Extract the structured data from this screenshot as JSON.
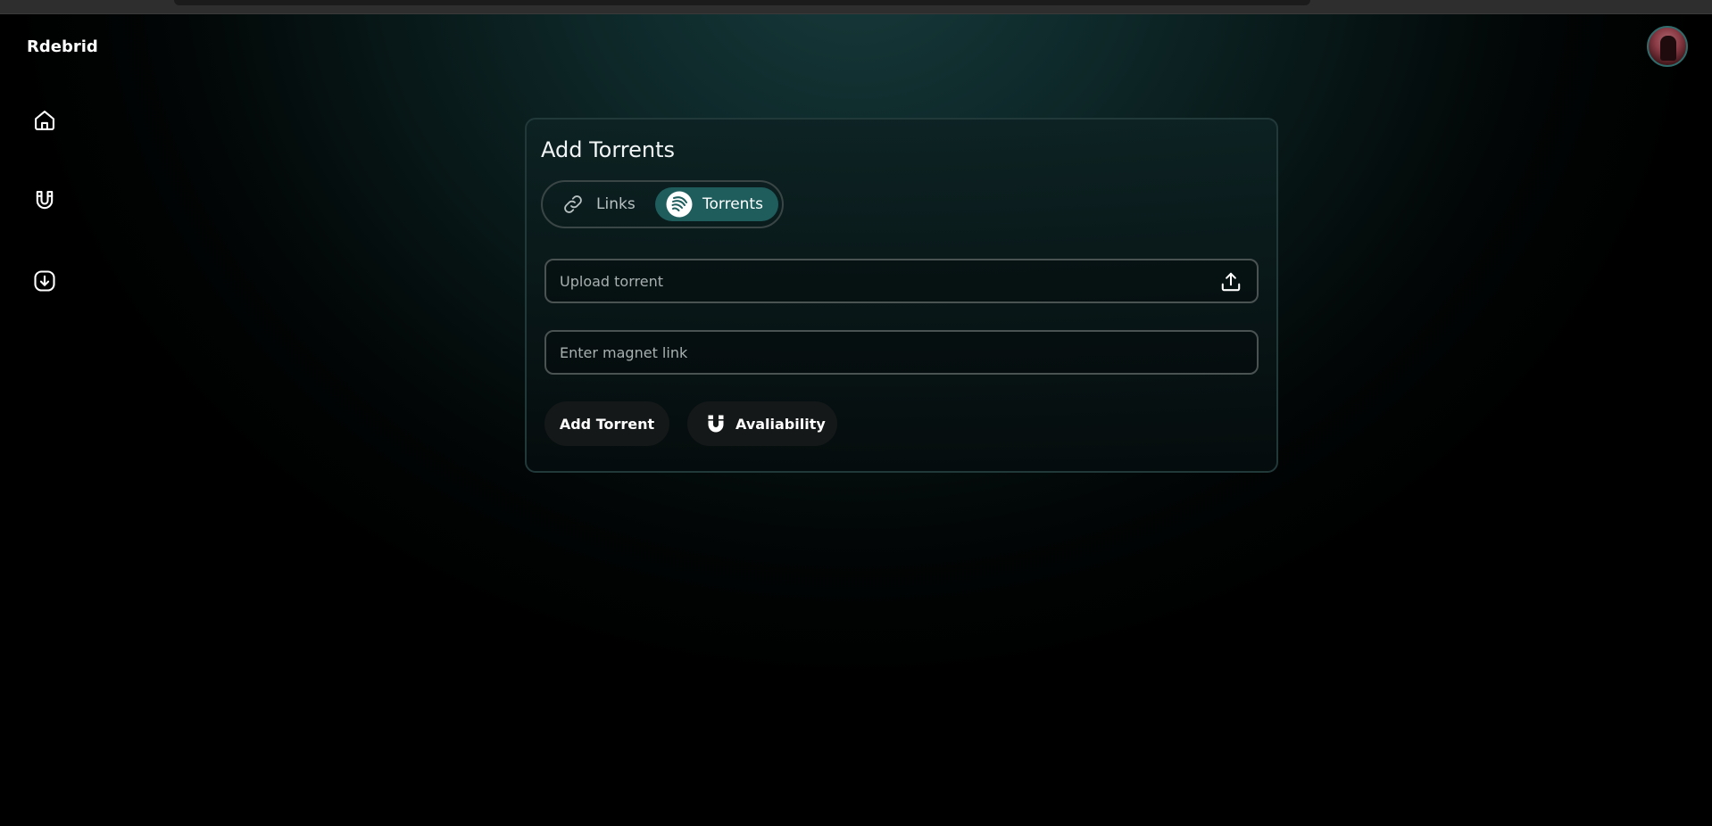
{
  "app": {
    "brand": "Rdebrid"
  },
  "nav": {
    "items": [
      {
        "name": "home",
        "icon": "home-icon"
      },
      {
        "name": "magnets",
        "icon": "magnet-icon"
      },
      {
        "name": "downloads",
        "icon": "download-icon"
      }
    ]
  },
  "card": {
    "title": "Add Torrents",
    "tabs": [
      {
        "label": "Links",
        "icon": "link-icon",
        "active": false
      },
      {
        "label": "Torrents",
        "icon": "torrent-icon",
        "active": true
      }
    ],
    "upload": {
      "placeholder": "Upload torrent",
      "icon": "upload-icon"
    },
    "magnet": {
      "placeholder": "Enter magnet link",
      "value": ""
    },
    "buttons": {
      "add_label": "Add Torrent",
      "availability_label": "Avaliability",
      "availability_icon": "magnet-icon"
    }
  },
  "colors": {
    "accent": "#1f5d5d",
    "avatar_ring": "#2f6c6b",
    "card_border": "#22393a"
  }
}
